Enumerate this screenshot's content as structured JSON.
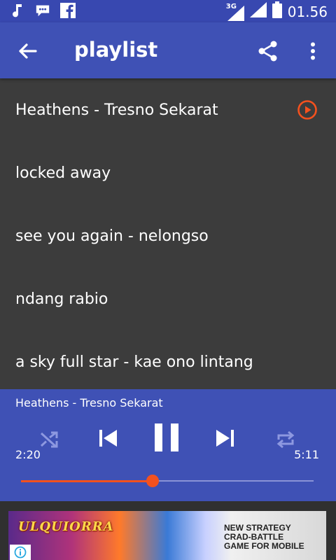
{
  "status_bar": {
    "network_label": "3G",
    "clock": "01.56",
    "icons": [
      "music-note-icon",
      "bbm-icon",
      "facebook-icon",
      "signal-icon",
      "signal-icon",
      "battery-icon"
    ]
  },
  "app_bar": {
    "title": "playlist",
    "back_icon": "arrow-back-icon",
    "share_icon": "share-icon",
    "more_icon": "more-vert-icon"
  },
  "playlist": {
    "items": [
      {
        "label": "Heathens - Tresno Sekarat",
        "playing": true
      },
      {
        "label": "locked away",
        "playing": false
      },
      {
        "label": "see you again - nelongso",
        "playing": false
      },
      {
        "label": "ndang rabio",
        "playing": false
      },
      {
        "label": "a sky full star - kae ono lintang",
        "playing": false
      }
    ]
  },
  "player": {
    "now_playing": "Heathens - Tresno Sekarat",
    "elapsed": "2:20",
    "duration": "5:11",
    "progress": 0.45,
    "accent_color": "#f4511e",
    "bar_color": "#3f51b5",
    "controls": [
      "shuffle-icon",
      "skip-previous-icon",
      "pause-icon",
      "skip-next-icon",
      "repeat-icon"
    ]
  },
  "ad": {
    "logo_text": "ULQUIORRA",
    "tagline_lines": [
      "NEW STRATEGY",
      "CRAD-BATTLE",
      "GAME FOR MOBILE"
    ]
  }
}
